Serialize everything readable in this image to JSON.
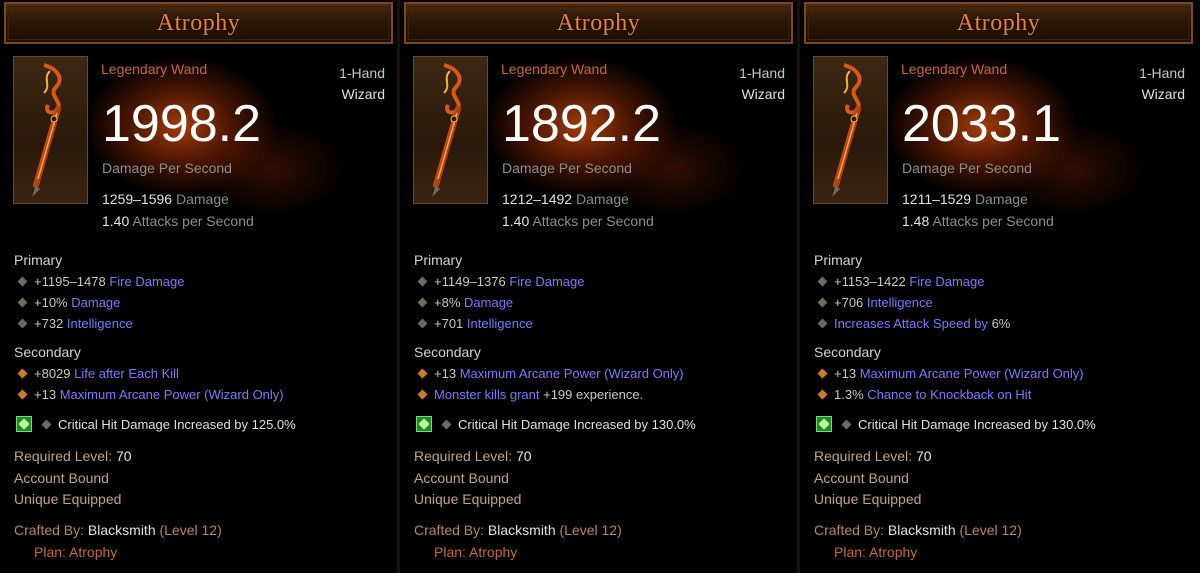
{
  "cards": [
    {
      "title": "Atrophy",
      "quality": "Legendary Wand",
      "hand": "1-Hand",
      "class": "Wizard",
      "dps": "1998.2",
      "dps_label": "Damage Per Second",
      "damage_range": "1259–1596",
      "damage_word": "Damage",
      "aps_value": "1.40",
      "aps_word": "Attacks per Second",
      "primary_header": "Primary",
      "primary": [
        {
          "value": "+1195–1478",
          "text": "Fire Damage"
        },
        {
          "value": "+10%",
          "text": "Damage"
        },
        {
          "value": "+732",
          "text": "Intelligence"
        }
      ],
      "secondary_header": "Secondary",
      "secondary": [
        {
          "value": "+8029",
          "text": "Life after Each Kill",
          "suffix": ""
        },
        {
          "value": "+13",
          "text": "Maximum Arcane Power (Wizard Only)",
          "suffix": ""
        }
      ],
      "crit": "Critical Hit Damage Increased by 125.0%",
      "req_label": "Required Level:",
      "req_value": "70",
      "account_bound": "Account Bound",
      "unique_equipped": "Unique Equipped",
      "crafted_label": "Crafted By:",
      "crafter": "Blacksmith",
      "crafter_level": "(Level 12)",
      "plan": "Plan: Atrophy"
    },
    {
      "title": "Atrophy",
      "quality": "Legendary Wand",
      "hand": "1-Hand",
      "class": "Wizard",
      "dps": "1892.2",
      "dps_label": "Damage Per Second",
      "damage_range": "1212–1492",
      "damage_word": "Damage",
      "aps_value": "1.40",
      "aps_word": "Attacks per Second",
      "primary_header": "Primary",
      "primary": [
        {
          "value": "+1149–1376",
          "text": "Fire Damage"
        },
        {
          "value": "+8%",
          "text": "Damage"
        },
        {
          "value": "+701",
          "text": "Intelligence"
        }
      ],
      "secondary_header": "Secondary",
      "secondary": [
        {
          "value": "+13",
          "text": "Maximum Arcane Power (Wizard Only)",
          "suffix": ""
        },
        {
          "value": "",
          "text": "Monster kills grant",
          "suffix": "+199 experience."
        }
      ],
      "crit": "Critical Hit Damage Increased by 130.0%",
      "req_label": "Required Level:",
      "req_value": "70",
      "account_bound": "Account Bound",
      "unique_equipped": "Unique Equipped",
      "crafted_label": "Crafted By:",
      "crafter": "Blacksmith",
      "crafter_level": "(Level 12)",
      "plan": "Plan: Atrophy"
    },
    {
      "title": "Atrophy",
      "quality": "Legendary Wand",
      "hand": "1-Hand",
      "class": "Wizard",
      "dps": "2033.1",
      "dps_label": "Damage Per Second",
      "damage_range": "1211–1529",
      "damage_word": "Damage",
      "aps_value": "1.48",
      "aps_word": "Attacks per Second",
      "primary_header": "Primary",
      "primary": [
        {
          "value": "+1153–1422",
          "text": "Fire Damage"
        },
        {
          "value": "+706",
          "text": "Intelligence"
        },
        {
          "value": "",
          "text": "Increases Attack Speed by",
          "suffix": "6%"
        }
      ],
      "secondary_header": "Secondary",
      "secondary": [
        {
          "value": "+13",
          "text": "Maximum Arcane Power (Wizard Only)",
          "suffix": ""
        },
        {
          "value": "1.3%",
          "text": "Chance to Knockback on Hit",
          "suffix": ""
        }
      ],
      "crit": "Critical Hit Damage Increased by 130.0%",
      "req_label": "Required Level:",
      "req_value": "70",
      "account_bound": "Account Bound",
      "unique_equipped": "Unique Equipped",
      "crafted_label": "Crafted By:",
      "crafter": "Blacksmith",
      "crafter_level": "(Level 12)",
      "plan": "Plan: Atrophy"
    }
  ],
  "icons": {
    "item": "wand-icon",
    "bullet": "diamond-bullet-icon",
    "gem": "emerald-gem-icon"
  },
  "colors": {
    "title": "#e8822f",
    "legendary": "#c86a2e",
    "magic_affix": "#7a7aff",
    "label_gold": "#c2a67c"
  }
}
